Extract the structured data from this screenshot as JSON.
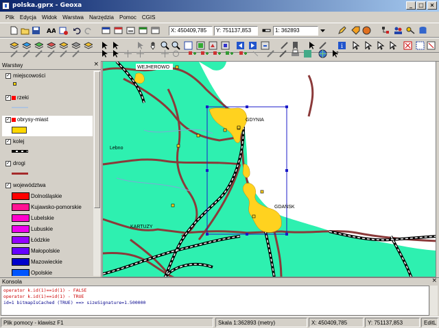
{
  "window": {
    "title": "polska.gprx - Geoxa"
  },
  "menu": [
    "Plik",
    "Edycja",
    "Widok",
    "Warstwa",
    "Narzędzia",
    "Pomoc",
    "CGIS"
  ],
  "toolbar": {
    "x_value": "X: 450409,785",
    "y_value": "Y: 751137,853",
    "scale_value": "1: 362893"
  },
  "layers_panel": {
    "title": "Warstwy",
    "items": [
      {
        "name": "miejscowości",
        "checked": true,
        "swatch": "#ffd700",
        "kind": "point"
      },
      {
        "name": "rzeki",
        "checked": true,
        "swatch": "#b0c4de",
        "kind": "line"
      },
      {
        "name": "obrysy-miast",
        "checked": true,
        "swatch": "#ffd700",
        "kind": "poly"
      },
      {
        "name": "kolej",
        "checked": true,
        "swatch": "#000000",
        "kind": "rail"
      },
      {
        "name": "drogi",
        "checked": true,
        "swatch": "#a52a2a",
        "kind": "road"
      },
      {
        "name": "województwa",
        "checked": true,
        "kind": "group"
      }
    ],
    "voivodeships": [
      {
        "name": "Dolnośląskie",
        "color": "#ff0000"
      },
      {
        "name": "Kujawsko-pomorskie",
        "color": "#ff1493"
      },
      {
        "name": "Lubelskie",
        "color": "#ff00cc"
      },
      {
        "name": "Lubuskie",
        "color": "#ee00ee"
      },
      {
        "name": "Łódzkie",
        "color": "#9400ff"
      },
      {
        "name": "Małopolskie",
        "color": "#6600ff"
      },
      {
        "name": "Mazowieckie",
        "color": "#0000cc"
      },
      {
        "name": "Opolskie",
        "color": "#0055ff"
      }
    ]
  },
  "map": {
    "labels": {
      "wejherowo": "WEJHEROWO",
      "gdynia": "GDYNIA",
      "lebno": "Lebno",
      "kartuzy": "KARTUZY",
      "gdansk": "GDAŃSK"
    },
    "land_color": "#2ef0b0",
    "road_color": "#8b3a3a",
    "city_color": "#ffd21f"
  },
  "console": {
    "title": "Konsola",
    "lines": [
      {
        "text": "operator k.id(1)==id(1) - FALSE",
        "cls": "red"
      },
      {
        "text": "operator k.id(1)==id(1) - TRUE",
        "cls": "red"
      },
      {
        "text": "  id=1 bitmapIsCached (TRUE) ==> sizeSignature=1.500000",
        "cls": ""
      }
    ]
  },
  "status": {
    "help": "Plik pomocy - klawisz F1",
    "scale": "Skala 1:362893 (metry)",
    "x": "X: 450409,785",
    "y": "Y: 751137,853",
    "edit": "EditL"
  }
}
